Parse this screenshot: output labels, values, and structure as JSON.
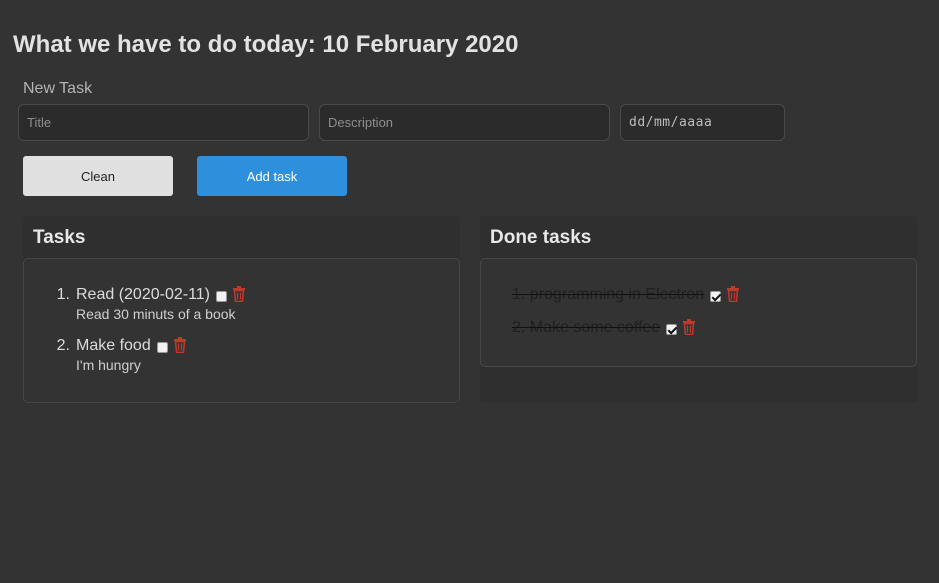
{
  "header": {
    "title": "What we have to do today: 10 February 2020"
  },
  "new_task": {
    "label": "New Task",
    "title_placeholder": "Title",
    "description_placeholder": "Description",
    "date_placeholder": "dd/mm/aaaa",
    "clean_label": "Clean",
    "add_label": "Add task"
  },
  "tasks_panel": {
    "heading": "Tasks",
    "items": [
      {
        "num": "1.",
        "title": "Read (2020-02-11)",
        "description": "Read 30 minuts of a book",
        "checked": false
      },
      {
        "num": "2.",
        "title": "Make food",
        "description": "I'm hungry",
        "checked": false
      }
    ]
  },
  "done_panel": {
    "heading": "Done tasks",
    "items": [
      {
        "text": "1. programming in Electron",
        "checked": true
      },
      {
        "text": "2. Make some coffee",
        "checked": true
      }
    ]
  },
  "colors": {
    "accent": "#2e8fdc",
    "trash": "#c0392b",
    "background": "#333333"
  },
  "icons": {
    "delete": "trash-icon",
    "checkbox": "checkbox-icon"
  }
}
